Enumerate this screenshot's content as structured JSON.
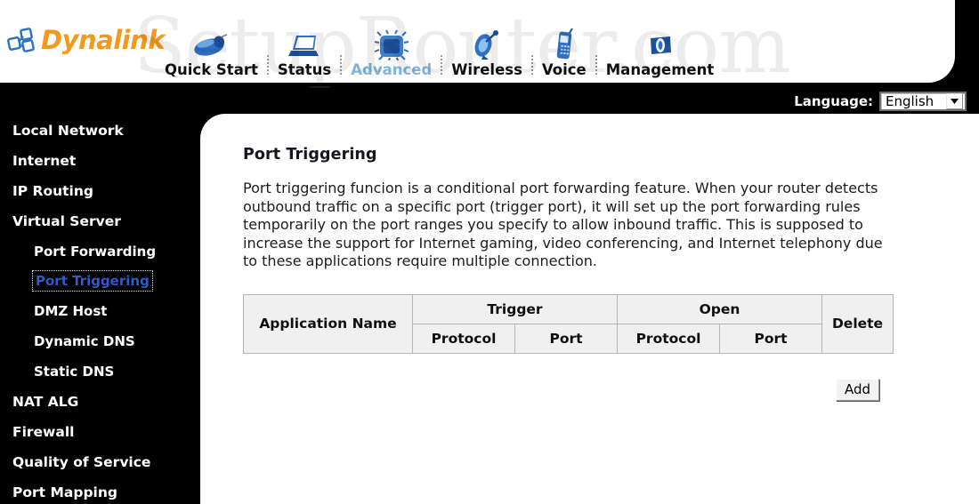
{
  "brand": {
    "name": "Dynalink",
    "logo_icon": "network-nodes-icon"
  },
  "nav": {
    "items": [
      {
        "label": "Quick Start",
        "icon": "mouse-icon",
        "active": false
      },
      {
        "label": "Status",
        "icon": "laptop-icon",
        "active": false
      },
      {
        "label": "Advanced",
        "icon": "chip-icon",
        "active": true
      },
      {
        "label": "Wireless",
        "icon": "satellite-dish-icon",
        "active": false
      },
      {
        "label": "Voice",
        "icon": "mobile-phone-icon",
        "active": false
      },
      {
        "label": "Management",
        "icon": "flag-icon",
        "active": false
      }
    ]
  },
  "language": {
    "label": "Language:",
    "value": "English",
    "options": [
      "English"
    ],
    "arrow_icon": "chevron-down-icon"
  },
  "sidebar": {
    "items": [
      {
        "label": "Local Network",
        "level": 0,
        "selected": false
      },
      {
        "label": "Internet",
        "level": 0,
        "selected": false
      },
      {
        "label": "IP Routing",
        "level": 0,
        "selected": false
      },
      {
        "label": "Virtual Server",
        "level": 0,
        "selected": false
      },
      {
        "label": "Port Forwarding",
        "level": 1,
        "selected": false
      },
      {
        "label": "Port Triggering",
        "level": 1,
        "selected": true
      },
      {
        "label": "DMZ Host",
        "level": 1,
        "selected": false
      },
      {
        "label": "Dynamic DNS",
        "level": 1,
        "selected": false
      },
      {
        "label": "Static DNS",
        "level": 1,
        "selected": false
      },
      {
        "label": "NAT ALG",
        "level": 0,
        "selected": false
      },
      {
        "label": "Firewall",
        "level": 0,
        "selected": false
      },
      {
        "label": "Quality of Service",
        "level": 0,
        "selected": false
      },
      {
        "label": "Port Mapping",
        "level": 0,
        "selected": false
      }
    ]
  },
  "main": {
    "title": "Port Triggering",
    "description": "Port triggering funcion is a conditional port forwarding feature. When your router detects outbound traffic on a specific port (trigger port), it will set up the port forwarding rules temporarily on the port ranges you specify to allow inbound traffic. This is supposed to increase the support for Internet gaming, video conferencing, and Internet telephony due to these applications require multiple connection.",
    "table": {
      "header_row1": {
        "application_name": "Application Name",
        "trigger": "Trigger",
        "open": "Open",
        "delete": "Delete"
      },
      "header_row2": {
        "trigger_protocol": "Protocol",
        "trigger_port": "Port",
        "open_protocol": "Protocol",
        "open_port": "Port"
      },
      "rows": []
    },
    "add_button": "Add"
  },
  "watermark": {
    "text": "SetupRouter.com"
  },
  "colors": {
    "brand_orange": "#f39a1e",
    "active_nav_blue": "#7fb4de",
    "selected_link_blue": "#2f5cc8",
    "sidebar_bg": "#000000",
    "table_bg": "#f0f0f0"
  }
}
